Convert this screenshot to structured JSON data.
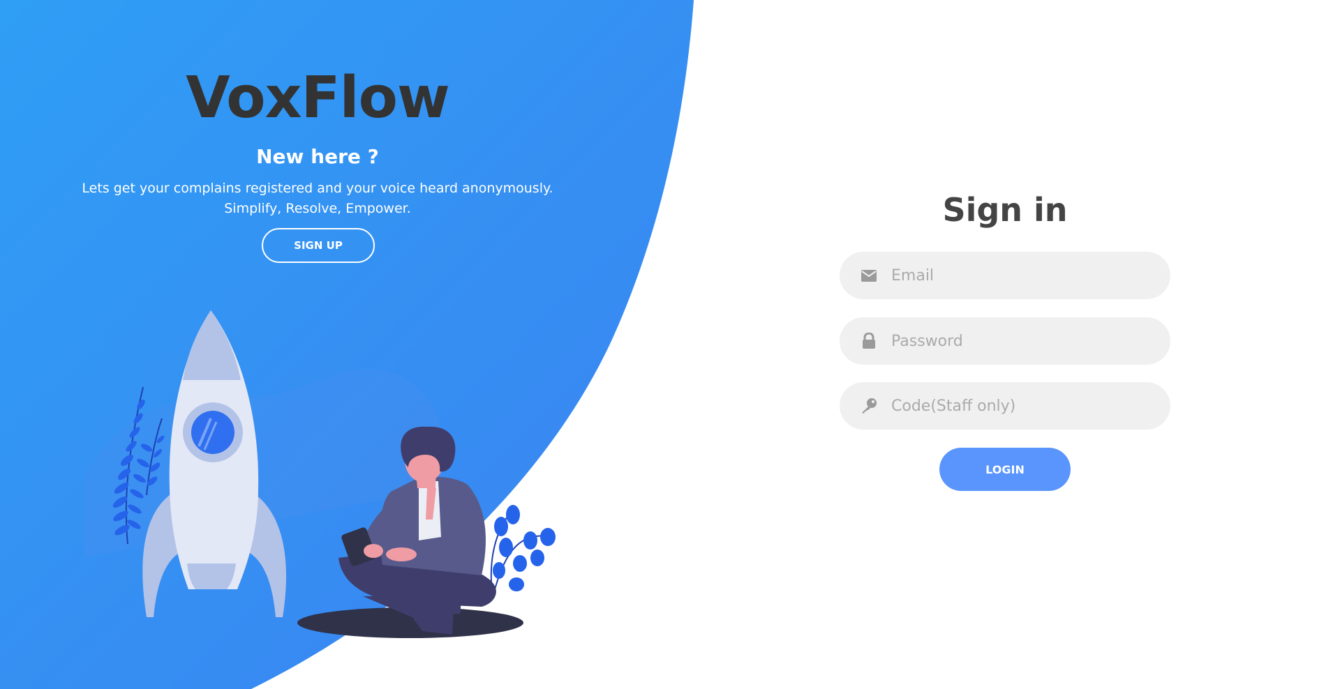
{
  "brand": {
    "name": "VoxFlow"
  },
  "left_panel": {
    "heading": "New here ?",
    "tagline_line1": "Lets get your complains registered and your voice heard anonymously.",
    "tagline_line2": "Simplify, Resolve, Empower.",
    "signup_label": "SIGN UP"
  },
  "signin": {
    "title": "Sign in",
    "email_placeholder": "Email",
    "password_placeholder": "Password",
    "code_placeholder": "Code(Staff only)",
    "login_label": "LOGIN"
  },
  "icons": {
    "email": "envelope-icon",
    "password": "lock-icon",
    "code": "key-icon"
  },
  "colors": {
    "accent": "#5995fd",
    "blue_gradient_start": "#2f9ef5",
    "blue_gradient_end": "#3b82f0",
    "field_background": "#f0f0f0",
    "text_dark": "#333333"
  }
}
